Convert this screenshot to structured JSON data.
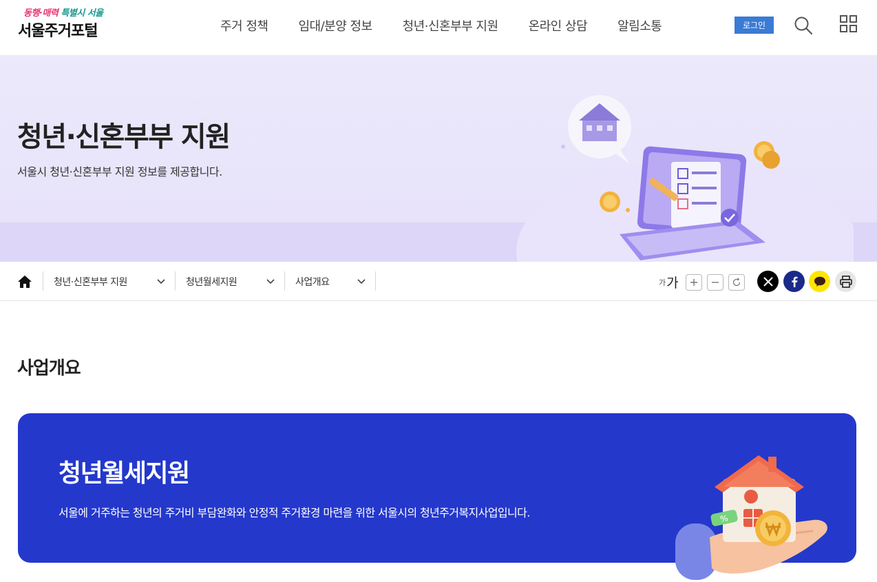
{
  "header": {
    "logo_slogan_a": "동행·매력",
    "logo_slogan_b": "특별시 서울",
    "logo_title": "서울주거포털",
    "nav": [
      "주거 정책",
      "임대/분양 정보",
      "청년·신혼부부 지원",
      "온라인 상담",
      "알림소통"
    ],
    "login_label": "로그인"
  },
  "hero": {
    "title": "청년·신혼부부 지원",
    "subtitle": "서울시 청년·신혼부부 지원 정보를 제공합니다."
  },
  "breadcrumb": {
    "items": [
      "청년·신혼부부 지원",
      "청년월세지원",
      "사업개요"
    ]
  },
  "font_tools": {
    "small": "가",
    "big": "가"
  },
  "main": {
    "section_title": "사업개요",
    "card_title": "청년월세지원",
    "card_desc": "서울에 거주하는 청년의 주거비 부담완화와 안정적 주거환경 마련을 위한 서울시의 청년주거복지사업입니다."
  },
  "colors": {
    "accent": "#3a7bd5",
    "card_bg": "#2438cc",
    "hero_bg": "#ece9fb"
  }
}
